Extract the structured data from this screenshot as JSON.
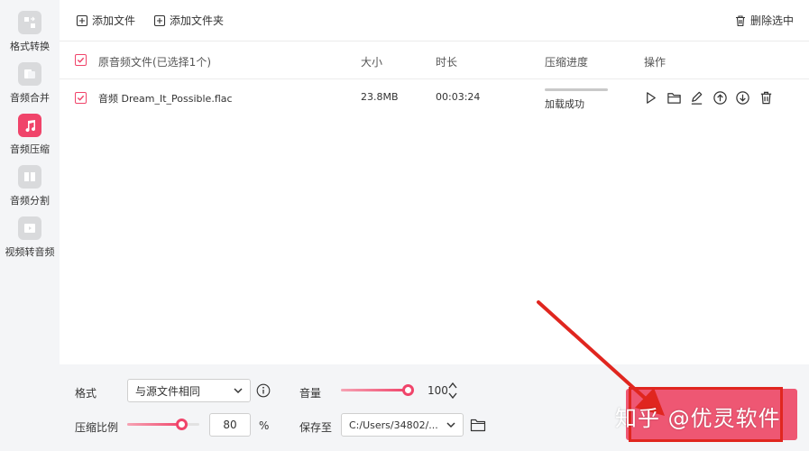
{
  "sidebar": {
    "items": [
      {
        "label": "格式转换",
        "icon": "format-convert-icon",
        "active": false
      },
      {
        "label": "音频合并",
        "icon": "audio-merge-icon",
        "active": false
      },
      {
        "label": "音频压缩",
        "icon": "music-note-icon",
        "active": true
      },
      {
        "label": "音频分割",
        "icon": "audio-split-icon",
        "active": false
      },
      {
        "label": "视频转音频",
        "icon": "video-to-audio-icon",
        "active": false
      }
    ]
  },
  "toolbar": {
    "add_file": "添加文件",
    "add_folder": "添加文件夹",
    "delete_selected": "删除选中"
  },
  "table": {
    "header": {
      "name": "原音频文件(已选择1个)",
      "size": "大小",
      "duration": "时长",
      "progress": "压缩进度",
      "actions": "操作"
    },
    "rows": [
      {
        "checked": true,
        "name": "音频 Dream_It_Possible.flac",
        "size": "23.8MB",
        "duration": "00:03:24",
        "status": "加载成功"
      }
    ]
  },
  "settings": {
    "format_label": "格式",
    "format_value": "与源文件相同",
    "volume_label": "音量",
    "volume_value": "100",
    "ratio_label": "压缩比例",
    "ratio_value": "80",
    "ratio_unit": "%",
    "save_label": "保存至",
    "save_path": "C:/Users/34802/..."
  },
  "overlay": {
    "watermark": "知乎 @优灵软件"
  },
  "colors": {
    "accent": "#f0446a",
    "highlight": "#e0261f"
  }
}
